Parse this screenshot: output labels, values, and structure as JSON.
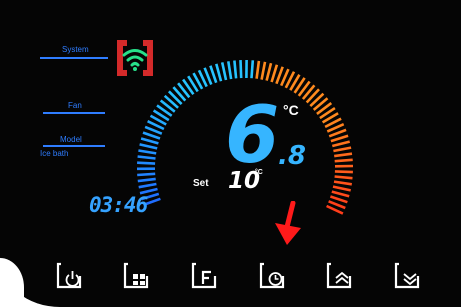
{
  "sidebar": {
    "system_label": "System",
    "fan_label": "Fan",
    "model_label": "Model",
    "mode_value": "Ice bath"
  },
  "status": {
    "wifi_icon": "wifi-icon",
    "highlight_color": "#d42a2a"
  },
  "clock": {
    "time": "03:46"
  },
  "temperature": {
    "current_integer": "6",
    "current_decimal": ".8",
    "unit": "°C",
    "set_label": "Set",
    "set_value": "10",
    "set_unit": "°C",
    "gauge_colors": {
      "cold": "#1f6dff",
      "mid": "#26c3ff",
      "warm": "#ff8a1e",
      "hot": "#ff3d1a"
    }
  },
  "buttons": [
    {
      "icon": "power-icon"
    },
    {
      "icon": "grid-icon"
    },
    {
      "icon": "fan-f-icon"
    },
    {
      "icon": "clock-icon"
    },
    {
      "icon": "arrow-up-icon"
    },
    {
      "icon": "arrow-down-icon"
    }
  ],
  "annotation": {
    "arrow_color": "#ff1a1a"
  }
}
